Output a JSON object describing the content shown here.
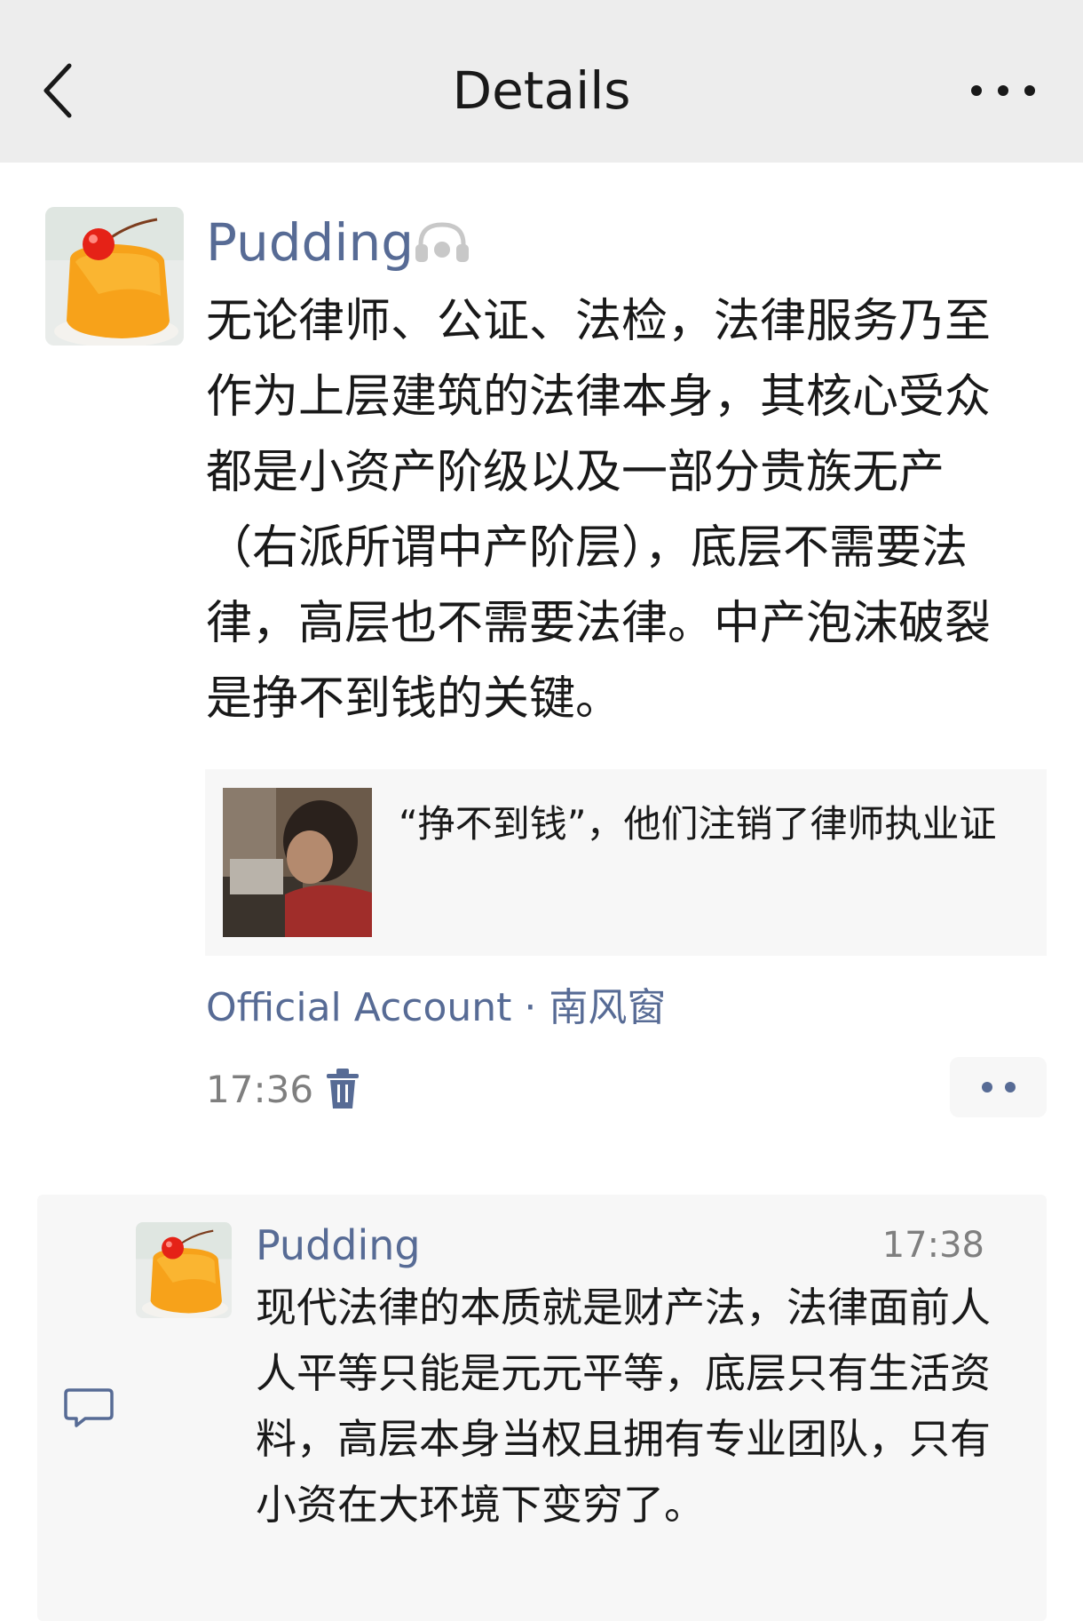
{
  "header": {
    "title": "Details",
    "back_icon": "chevron-left-icon",
    "more_icon": "more-horizontal-icon"
  },
  "post": {
    "author": "Pudding",
    "listen_icon": "headphones-icon",
    "text": "无论律师、公证、法检，法律服务乃至作为上层建筑的法律本身，其核心受众都是小资产阶级以及一部分贵族无产（右派所谓中产阶层），底层不需要法律，高层也不需要法律。中产泡沫破裂是挣不到钱的关键。",
    "link_card": {
      "title": "“挣不到钱”，他们注销了律师执业证"
    },
    "source_label": "Official Account · 南风窗",
    "time": "17:36",
    "delete_icon": "trash-icon",
    "action_icon": "more-dots-icon"
  },
  "comments": [
    {
      "author": "Pudding",
      "time": "17:38",
      "text": "现代法律的本质就是财产法，法律面前人人平等只能是元元平等，底层只有生活资料，高层本身当权且拥有专业团队，只有小资在大环境下变穷了。"
    }
  ],
  "comment_section_icon": "comment-bubble-icon",
  "colors": {
    "link_blue": "#576b95",
    "header_bg": "#ededed",
    "card_bg": "#f7f7f7",
    "text": "#191919",
    "muted": "#7f7f7f"
  }
}
